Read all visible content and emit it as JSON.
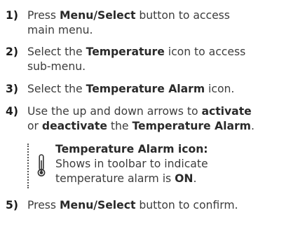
{
  "steps": [
    {
      "number": "1)",
      "lines": [
        {
          "parts": [
            {
              "t": "Press ",
              "b": false
            },
            {
              "t": "Menu/Select",
              "b": true
            },
            {
              "t": " button to access",
              "b": false
            }
          ]
        },
        {
          "parts": [
            {
              "t": "main menu.",
              "b": false
            }
          ]
        }
      ]
    },
    {
      "number": "2)",
      "lines": [
        {
          "parts": [
            {
              "t": "Select the ",
              "b": false
            },
            {
              "t": "Temperature",
              "b": true
            },
            {
              "t": " icon to access",
              "b": false
            }
          ]
        },
        {
          "parts": [
            {
              "t": "sub-menu.",
              "b": false
            }
          ]
        }
      ]
    },
    {
      "number": "3)",
      "lines": [
        {
          "parts": [
            {
              "t": "Select the ",
              "b": false
            },
            {
              "t": "Temperature Alarm",
              "b": true
            },
            {
              "t": " icon.",
              "b": false
            }
          ]
        }
      ]
    },
    {
      "number": "4)",
      "lines": [
        {
          "parts": [
            {
              "t": "Use the up and down arrows to ",
              "b": false
            },
            {
              "t": "activate",
              "b": true
            }
          ]
        },
        {
          "parts": [
            {
              "t": "or ",
              "b": false
            },
            {
              "t": "deactivate",
              "b": true
            },
            {
              "t": " the ",
              "b": false
            },
            {
              "t": "Temperature Alarm",
              "b": true
            },
            {
              "t": ".",
              "b": false
            }
          ]
        }
      ]
    },
    {
      "number": "5)",
      "lines": [
        {
          "parts": [
            {
              "t": "Press ",
              "b": false
            },
            {
              "t": "Menu/Select",
              "b": true
            },
            {
              "t": " button to confirm.",
              "b": false
            }
          ]
        }
      ]
    }
  ],
  "note": {
    "icon": "thermometer-icon",
    "title": "Temperature Alarm icon:",
    "line1": "Shows in toolbar to indicate",
    "line2_text": "temperature alarm is ",
    "line2_bold": "ON",
    "line2_end": "."
  }
}
